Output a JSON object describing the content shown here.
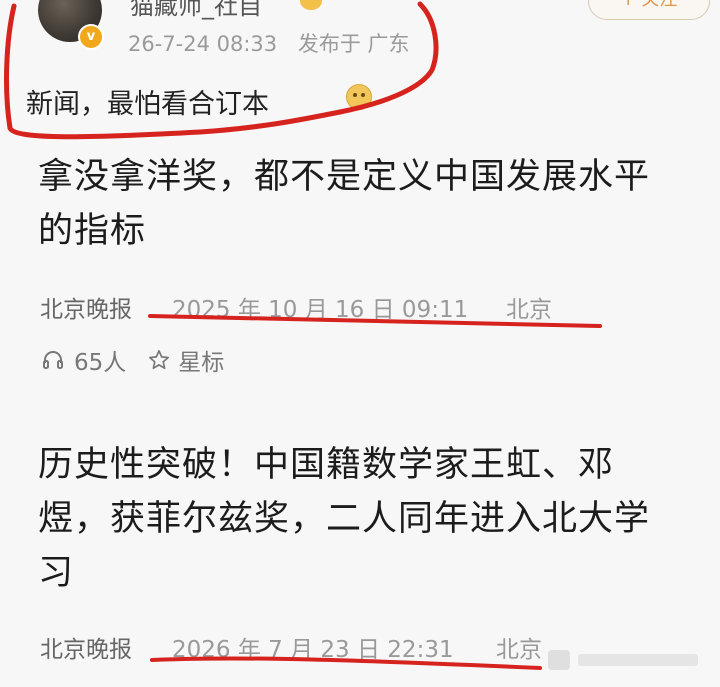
{
  "post": {
    "username": "猫藏师_社自",
    "follow_label": "+ 关注",
    "date": "26-7-24 08:33",
    "location": "发布于 广东",
    "text": "新闻，最怕看合订本"
  },
  "articles": [
    {
      "title": "拿没拿洋奖，都不是定义中国发展水平的指标",
      "source": "北京晚报",
      "datetime": "2025 年 10 月 16 日  09:11",
      "city": "北京",
      "listeners": "65人",
      "star_label": "星标"
    },
    {
      "title": "历史性突破！中国籍数学家王虹、邓煜，获菲尔兹奖，二人同年进入北大学习",
      "source": "北京晚报",
      "datetime": "2026 年 7 月 23 日  22:31",
      "city": "北京"
    }
  ],
  "colors": {
    "annotation_red": "#d6231e",
    "background": "#f7f7f7",
    "badge": "#f2a81d"
  },
  "icons": [
    "headphone-icon",
    "star-icon",
    "verified-badge-icon",
    "smiley-emoji-icon"
  ]
}
